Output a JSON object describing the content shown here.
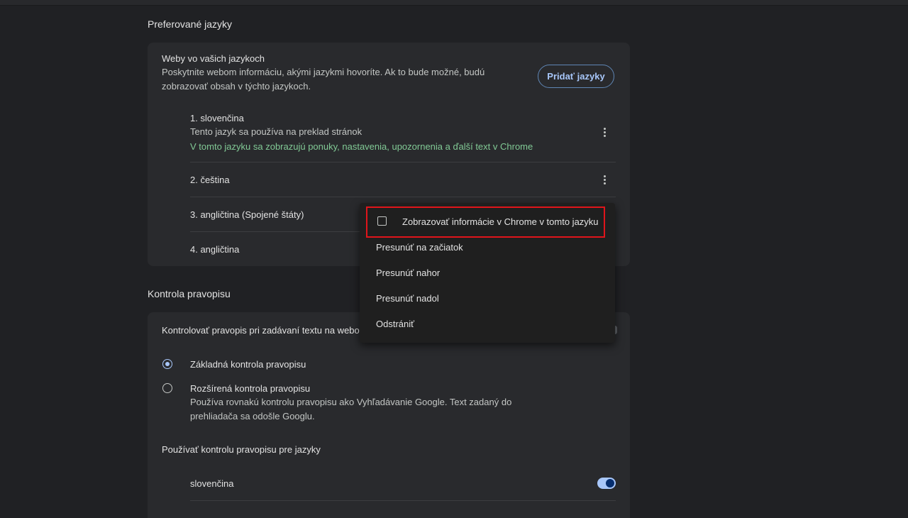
{
  "languages_section": {
    "title": "Preferované jazyky",
    "card": {
      "heading": "Weby vo vašich jazykoch",
      "description_line1": "Poskytnite webom informáciu, akými jazykmi hovoríte. Ak to bude možné, budú",
      "description_line2": "zobrazovať obsah v týchto jazykoch.",
      "add_button": "Pridať jazyky",
      "items": [
        {
          "label": "1. slovenčina",
          "sub1": "Tento jazyk sa používa na preklad stránok",
          "sub2": "V tomto jazyku sa zobrazujú ponuky, nastavenia, upozornenia a ďalší text v Chrome"
        },
        {
          "label": "2. čeština"
        },
        {
          "label": "3. angličtina (Spojené štáty)"
        },
        {
          "label": "4. angličtina"
        }
      ]
    }
  },
  "context_menu": {
    "checkbox_label": "Zobrazovať informácie v Chrome v tomto jazyku",
    "checkbox_checked": false,
    "items": [
      "Presunúť na začiatok",
      "Presunúť nahor",
      "Presunúť nadol",
      "Odstrániť"
    ]
  },
  "spellcheck_section": {
    "title": "Kontrola pravopisu",
    "toggle_label": "Kontrolovať pravopis pri zadávaní textu na webo",
    "options": [
      {
        "label": "Základná kontrola pravopisu",
        "selected": true
      },
      {
        "label": "Rozšírená kontrola pravopisu",
        "selected": false,
        "desc_line1": "Používa rovnakú kontrolu pravopisu ako Vyhľadávanie Google. Text zadaný do",
        "desc_line2": "prehliadača sa odošle Googlu."
      }
    ],
    "languages_heading": "Používať kontrolu pravopisu pre jazyky",
    "languages": [
      {
        "label": "slovenčina",
        "enabled": true
      }
    ]
  },
  "colors": {
    "background": "#202124",
    "card": "#292a2d",
    "accent": "#a8c7fa",
    "green_text": "#81c995",
    "highlight": "#e0151b"
  }
}
